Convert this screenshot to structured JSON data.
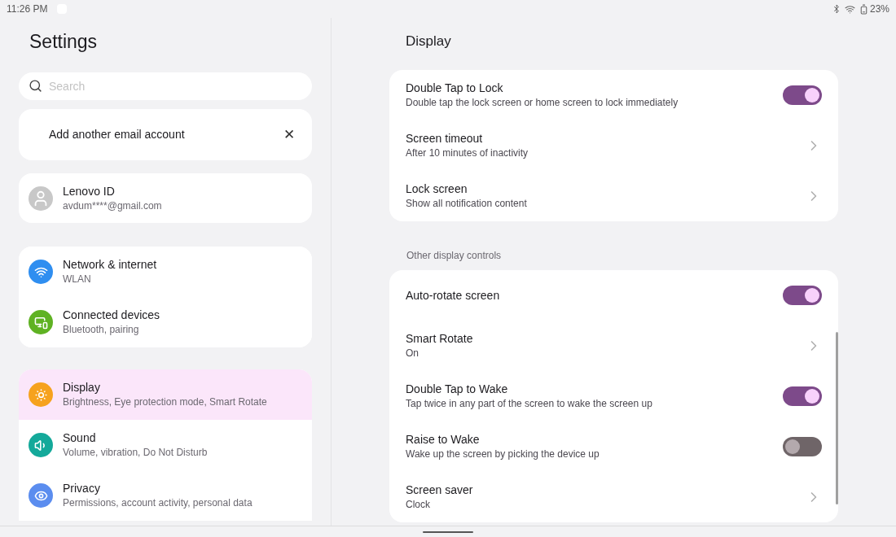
{
  "status_bar": {
    "time": "11:26 PM",
    "battery": "23%"
  },
  "sidebar": {
    "title": "Settings",
    "search": {
      "placeholder": "Search"
    },
    "account_prompt": {
      "label": "Add another email account",
      "close": "✕"
    },
    "account": {
      "title": "Lenovo ID",
      "subtitle": "avdum****@gmail.com"
    },
    "groups": [
      [
        {
          "kind": "wifi",
          "title": "Network & internet",
          "subtitle": "WLAN",
          "color": "#2f8ef0",
          "selected": false
        },
        {
          "kind": "devices",
          "title": "Connected devices",
          "subtitle": "Bluetooth, pairing",
          "color": "#5fb223",
          "selected": false
        }
      ],
      [
        {
          "kind": "display",
          "title": "Display",
          "subtitle": "Brightness, Eye protection mode, Smart Rotate",
          "color": "#f6a21e",
          "selected": true
        },
        {
          "kind": "sound",
          "title": "Sound",
          "subtitle": "Volume, vibration, Do Not Disturb",
          "color": "#14a99a",
          "selected": false
        },
        {
          "kind": "privacy",
          "title": "Privacy",
          "subtitle": "Permissions, account activity, personal data",
          "color": "#5b8def",
          "selected": false
        }
      ]
    ]
  },
  "content": {
    "title": "Display",
    "sections": [
      {
        "rows": [
          {
            "kind": "toggle",
            "title": "Double Tap to Lock",
            "subtitle": "Double tap the lock screen or home screen to lock immediately",
            "on": true
          },
          {
            "kind": "link",
            "title": "Screen timeout",
            "subtitle": "After 10 minutes of inactivity"
          },
          {
            "kind": "link",
            "title": "Lock screen",
            "subtitle": "Show all notification content"
          }
        ]
      },
      {
        "heading": "Other display controls",
        "rows": [
          {
            "kind": "toggle",
            "title": "Auto-rotate screen",
            "on": true
          },
          {
            "kind": "link",
            "title": "Smart Rotate",
            "subtitle": "On"
          },
          {
            "kind": "toggle",
            "title": "Double Tap to Wake",
            "subtitle": "Tap twice in any part of the screen to wake the screen up",
            "on": true
          },
          {
            "kind": "toggle",
            "title": "Raise to Wake",
            "subtitle": "Wake up the screen by picking the device up",
            "on": false
          },
          {
            "kind": "link",
            "title": "Screen saver",
            "subtitle": "Clock"
          }
        ]
      }
    ]
  }
}
